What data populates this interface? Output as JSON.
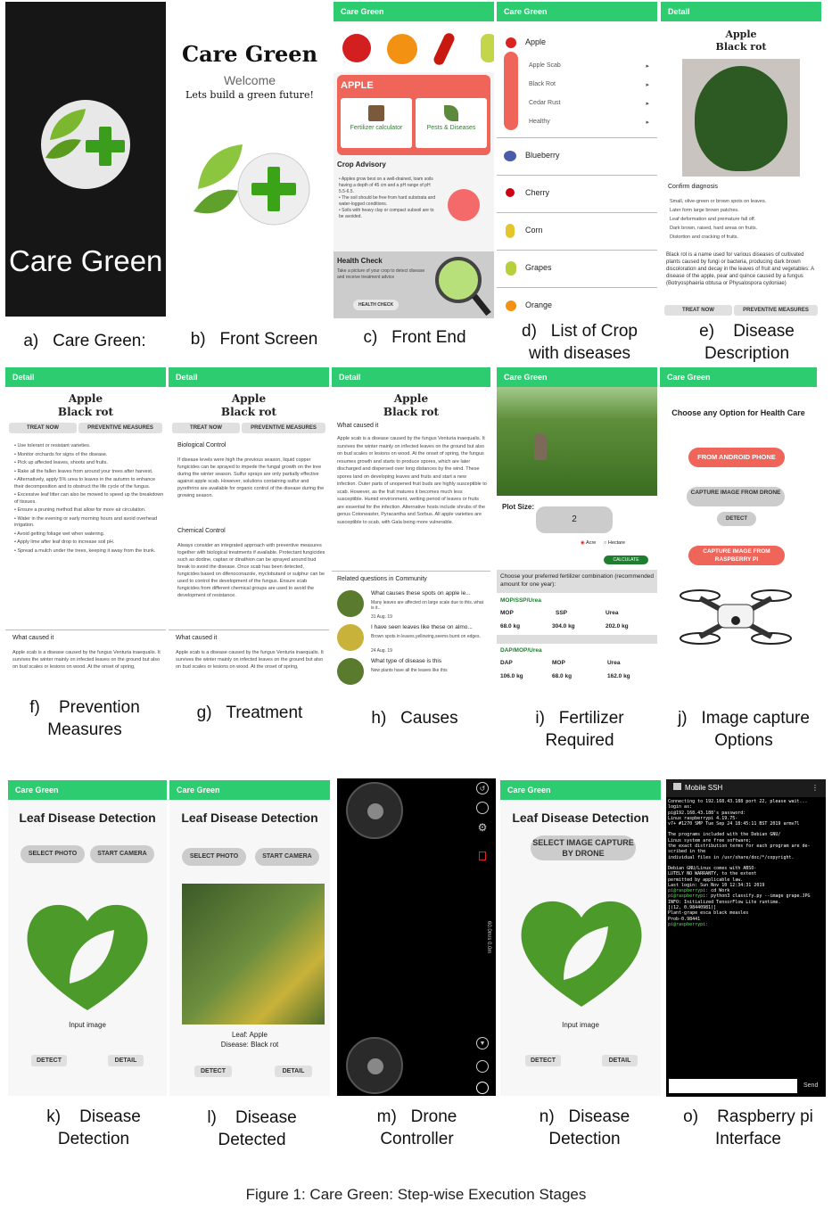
{
  "app_name": "Care Green",
  "a": {
    "title": "Care Green"
  },
  "b": {
    "title": "Care Green",
    "welcome": "Welcome",
    "tagline": "Lets build a green future!"
  },
  "c": {
    "bar": "Care Green",
    "crop": "APPLE",
    "card1": "Fertilizer calculator",
    "card2": "Pests & Diseases",
    "advisory_title": "Crop Advisory",
    "advisory": "• Apples grow best on a well-drained, loam soils having a depth of 45 cm and a pH range of pH 5.5-6.5.\n• The soil should be free from hard substrata and water-logged conditions.\n• Soils with heavy clay or compact subsoil are to be avoided.",
    "hc_title": "Health Check",
    "hc_text": "Take a picture of your crop to detect disease and receive treatment advice",
    "hc_btn": "HEALTH CHECK"
  },
  "d": {
    "bar": "Care Green",
    "apple": "Apple",
    "diseases": [
      "Apple Scab",
      "Black Rot",
      "Cedar Rust",
      "Healthy"
    ],
    "crops": [
      "Blueberry",
      "Cherry",
      "Corn",
      "Grapes",
      "Orange"
    ]
  },
  "e": {
    "bar": "Detail",
    "crop": "Apple",
    "disease": "Black rot",
    "confirm": "Confirm diagnosis",
    "symptoms": [
      "Small, olive-green or brown spots on leaves.",
      "Later form large brown patches.",
      "Leaf deformation and premature fall off.",
      "Dark brown, raised, hard areas on fruits.",
      "Distortion and cracking of fruits."
    ],
    "desc": "Black rot is a name used for various diseases of cultivated plants caused by fungi or bacteria, producing dark brown discoloration and decay in the leaves of fruit and vegetables: A disease of the apple, pear and quince caused by a fungus (Botryosphaeria obtusa or Physalospora cydoniae)",
    "btn1": "TREAT NOW",
    "btn2": "PREVENTIVE MEASURES"
  },
  "f": {
    "bar": "Detail",
    "crop": "Apple",
    "disease": "Black rot",
    "btn1": "TREAT NOW",
    "btn2": "PREVENTIVE MEASURES",
    "items": [
      "Use tolerant or resistant varieties.",
      "Monitor orchards for signs of the disease.",
      "Pick up affected leaves, shoots and fruits.",
      "Rake all the fallen leaves from around your trees after harvest.",
      "Alternatively, apply 5% urea to leaves in the autumn to enhance their decomposition and to obstruct the life cycle of the fungus.",
      "Excessive leaf litter can also be mowed to speed up the breakdown of tissues.",
      "Ensure a pruning method that allow for more air circulation.",
      "Water in the evening or early morning hours and avoid overhead irrigation.",
      "Avoid getting foliage wet when watering.",
      "Apply lime after leaf drop to increase soil pH.",
      "Spread a mulch under the trees, keeping it away from the trunk."
    ],
    "caused": "What caused it",
    "caused_text": "Apple scab is a disease caused by the fungus Venturia inaequalis. It survives the winter mainly on infected leaves on the ground but also on bud scales or lesions on wood. At the onset of spring,"
  },
  "g": {
    "bar": "Detail",
    "crop": "Apple",
    "disease": "Black rot",
    "btn1": "TREAT NOW",
    "btn2": "PREVENTIVE MEASURES",
    "bio": "Biological Control",
    "bio_text": "If disease levels were high the previous season, liquid copper fungicides can be sprayed to impede the fungal growth on the tree during the winter season. Sulfur sprays are only partially effective against apple scab. However, solutions containing sulfur and pyrethrins are available for organic control of the disease during the growing season.",
    "chem": "Chemical Control",
    "chem_text": "Always consider an integrated approach with preventive measures together with biological treatments if available. Protectant fungicides such as dodine, captan or dinathion can be sprayed around bud break to avoid the disease. Once scab has been detected, fungicides based on difenoconazole, myclobutanil or sulphur can be used to control the development of the fungus. Ensure scab fungicides from different chemical groups are used to avoid the development of resistance.",
    "caused": "What caused it",
    "caused_text": "Apple scab is a disease caused by the fungus Venturia inaequalis. It survives the winter mainly on infected leaves on the ground but also on bud scales or lesions on wood. At the onset of spring,"
  },
  "h": {
    "bar": "Detail",
    "crop": "Apple",
    "disease": "Black rot",
    "caused": "What caused it",
    "text": "Apple scab is a disease caused by the fungus Venturia inaequalis. It survives the winter mainly on infected leaves on the ground but also on bud scales or lesions on wood. At the onset of spring, the fungus resumes growth and starts to produce spores, which are later discharged and dispersed over long distances by the wind. These spores land on developing leaves and fruits and start a new infection. Outer parts of unopened fruit buds are highly susceptible to scab. However, as the fruit matures it becomes much less susceptible. Humid environment, wetting period of leaves or fruits are essential for the infection. Alternative hosts include shrubs of the genus Cotoneaster, Pyracantha and Sorbus. All apple varieties are susceptible to scab, with Gala being more vulnerable.",
    "related": "Related questions in Community",
    "questions": [
      {
        "q": "What causes these spots on apple le...",
        "a": "Many leaves are affected on large scale due to this..what is it..",
        "d": "31 Aug. 19"
      },
      {
        "q": "I have seen leaves like these on almo...",
        "a": "Brown spots in leaves,yellowing,seems burnt on edges.",
        "d": "24 Aug. 19"
      },
      {
        "q": "What type of disease is this",
        "a": "New plants have all the leaves like this",
        "d": ""
      }
    ]
  },
  "i": {
    "bar": "Care Green",
    "plot": "Plot Size:",
    "value": "2",
    "acre": "Acre",
    "hectare": "Hectare",
    "calc": "CALCULATE",
    "choose": "Choose your preferred fertilizer combination (recommended amount for one year):",
    "combo1": "MOP/SSP/Urea",
    "h1": [
      "MOP",
      "SSP",
      "Urea"
    ],
    "v1": [
      "68.0 kg",
      "304.0 kg",
      "202.0 kg"
    ],
    "combo2": "DAP/MOP/Urea",
    "h2": [
      "DAP",
      "MOP",
      "Urea"
    ],
    "v2": [
      "106.0 kg",
      "68.0 kg",
      "162.0 kg"
    ]
  },
  "j": {
    "bar": "Care Green",
    "title": "Choose any Option for Health Care",
    "opt1": "FROM ANDROID PHONE",
    "opt2": "CAPTURE IMAGE FROM DRONE",
    "detect": "DETECT",
    "opt3": "CAPTURE IMAGE FROM RASPBERRY PI"
  },
  "k": {
    "bar": "Care Green",
    "title": "Leaf Disease Detection",
    "select": "SELECT PHOTO",
    "camera": "START CAMERA",
    "input": "Input image",
    "detect": "DETECT",
    "detail": "DETAIL"
  },
  "l": {
    "bar": "Care Green",
    "title": "Leaf Disease Detection",
    "select": "SELECT PHOTO",
    "camera": "START CAMERA",
    "leaf": "Leaf: Apple",
    "disease": "Disease: Black rot",
    "detect": "DETECT",
    "detail": "DETAIL"
  },
  "m": {
    "speed1": "60.0m/s",
    "speed2": "0.0m"
  },
  "n": {
    "bar": "Care Green",
    "title": "Leaf Disease Detection",
    "select": "SELECT IMAGE CAPTURE BY DRONE",
    "input": "Input image",
    "detect": "DETECT",
    "detail": "DETAIL"
  },
  "o": {
    "app": "Mobile SSH",
    "lines": [
      "Connecting to 192.168.43.188 port 22, please wait...",
      "login as:",
      "pi@192.168.43.188's password:",
      "Linux raspberrypi 4.19.75-",
      "v7+ #1270 SMP Tue Sep 24 18:45:11 BST 2019 armv7l",
      "",
      "The programs included with the Debian GNU/",
      "Linux system are free software;",
      "the exact distribution terms for each program are de-",
      "scribed in the",
      "individual files in /usr/share/doc/*/copyright.",
      "",
      "Debian GNU/Linux comes with ABSO-",
      "LUTELY NO WARRANTY, to the extent",
      "permitted by applicable law.",
      "Last login: Sun Nov 10 12:34:31 2019"
    ],
    "cmd1": "cd Work",
    "cmd2": "python3 classify.py --image grape.JPG",
    "out": [
      "INFO: Initialized TensorFlow Lite runtime.",
      "[(12, 0.98440981)]",
      "Plant-grape esca black measles",
      "Prob-0.98441"
    ],
    "send": "Send"
  },
  "captions": {
    "a": [
      "a)",
      "Care Green:"
    ],
    "b": [
      "b)",
      "Front Screen"
    ],
    "c": [
      "c)",
      "Front End"
    ],
    "d": [
      "d)",
      "List of Crop",
      "with diseases"
    ],
    "e": [
      "e)",
      "Disease",
      "Description"
    ],
    "f": [
      "f)",
      "Prevention",
      "Measures"
    ],
    "g": [
      "g)",
      "Treatment"
    ],
    "h": [
      "h)",
      "Causes"
    ],
    "i": [
      "i)",
      "Fertilizer",
      "Required"
    ],
    "j": [
      "j)",
      "Image capture",
      "Options"
    ],
    "k": [
      "k)",
      "Disease",
      "Detection"
    ],
    "l": [
      "l)",
      "Disease",
      "Detected"
    ],
    "m": [
      "m)",
      "Drone",
      "Controller"
    ],
    "n": [
      "n)",
      "Disease",
      "Detection"
    ],
    "o": [
      "o)",
      "Raspberry pi",
      "Interface"
    ]
  },
  "figure_caption": "Figure 1: Care Green: Step-wise Execution Stages"
}
